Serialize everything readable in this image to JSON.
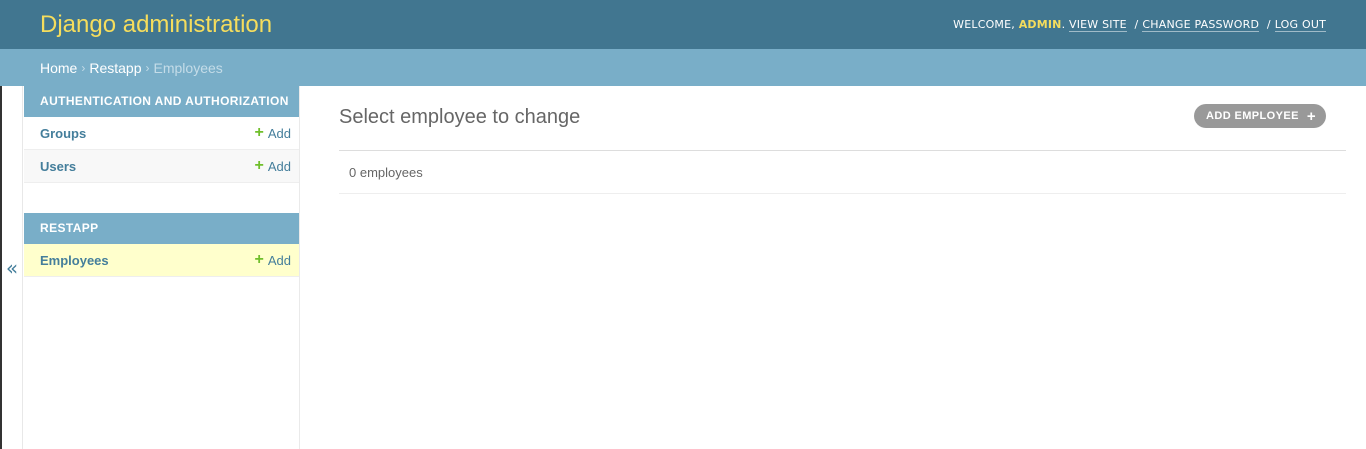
{
  "header": {
    "branding": "Django administration",
    "welcome": "Welcome,",
    "username": "admin",
    "view_site": "View site",
    "change_password": "Change password",
    "log_out": "Log out"
  },
  "breadcrumbs": {
    "home": "Home",
    "app": "Restapp",
    "current": "Employees"
  },
  "sidebar": {
    "toggle_glyph": "«",
    "modules": [
      {
        "caption": "Authentication and Authorization",
        "models": [
          {
            "name": "Groups",
            "add": "Add"
          },
          {
            "name": "Users",
            "add": "Add"
          }
        ]
      },
      {
        "caption": "Restapp",
        "models": [
          {
            "name": "Employees",
            "add": "Add"
          }
        ]
      }
    ]
  },
  "content": {
    "title": "Select employee to change",
    "add_button": "Add employee",
    "result_count": "0 employees"
  },
  "colors": {
    "header_bg": "#417690",
    "breadcrumb_bg": "#79aec8",
    "branding": "#f5dd5d",
    "link": "#447e9b",
    "add_plus": "#70bf2b",
    "current_row": "#ffffcc"
  },
  "icons": {
    "plus": "+",
    "collapse": "chevron-double-left"
  }
}
